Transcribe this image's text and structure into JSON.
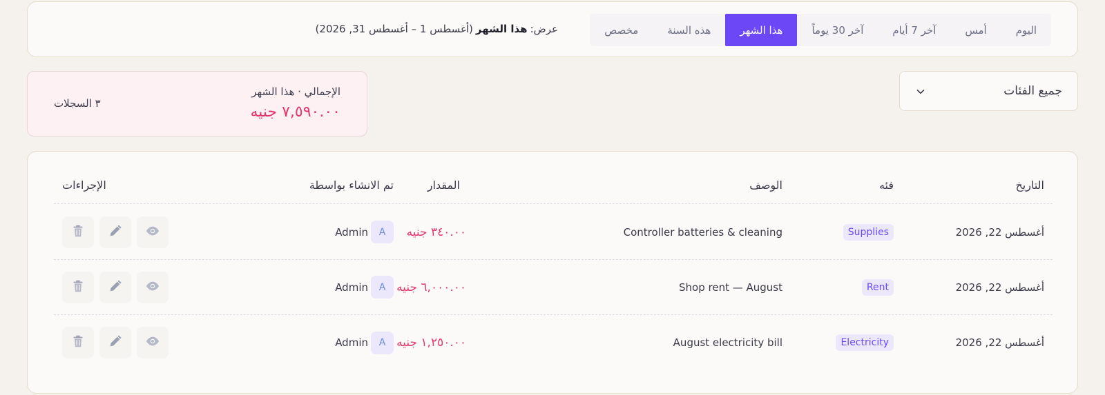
{
  "filters": {
    "options": [
      "اليوم",
      "أمس",
      "آخر 7 أيام",
      "آخر 30 يوماً",
      "هذا الشهر",
      "هذه السنة",
      "مخصص"
    ],
    "active_index": 4,
    "range_prefix": "عرض:",
    "range_strong": "هذا الشهر",
    "range_dates": "(أغسطس 1 – أغسطس 31, 2026)"
  },
  "category_select": {
    "value": "جميع الفئات"
  },
  "summary": {
    "label": "الإجمالي · هذا الشهر",
    "total": "٧,٥٩٠.٠٠ جنيه",
    "count": "٣ السجلات"
  },
  "table": {
    "headers": {
      "date": "التاريخ",
      "category": "فئه",
      "description": "الوصف",
      "amount": "المقدار",
      "created_by": "تم الانشاء بواسطة",
      "actions": "الإجراءات"
    },
    "rows": [
      {
        "date": "أغسطس 22, 2026",
        "category": "Supplies",
        "description": "Controller batteries & cleaning",
        "amount": "٣٤٠.٠٠ جنيه",
        "creator_initial": "A",
        "creator_name": "Admin"
      },
      {
        "date": "أغسطس 22, 2026",
        "category": "Rent",
        "description": "Shop rent — August",
        "amount": "٦,٠٠٠.٠٠ جنيه",
        "creator_initial": "A",
        "creator_name": "Admin"
      },
      {
        "date": "أغسطس 22, 2026",
        "category": "Electricity",
        "description": "August electricity bill",
        "amount": "١,٢٥٠.٠٠ جنيه",
        "creator_initial": "A",
        "creator_name": "Admin"
      }
    ]
  },
  "icons": {
    "view": "eye-icon",
    "edit": "pencil-icon",
    "delete": "trash-icon",
    "dropdown": "chevron-down-icon"
  },
  "colors": {
    "accent": "#6b47f6",
    "amount": "#e0386a",
    "summary_bg": "#fdf1f4"
  }
}
